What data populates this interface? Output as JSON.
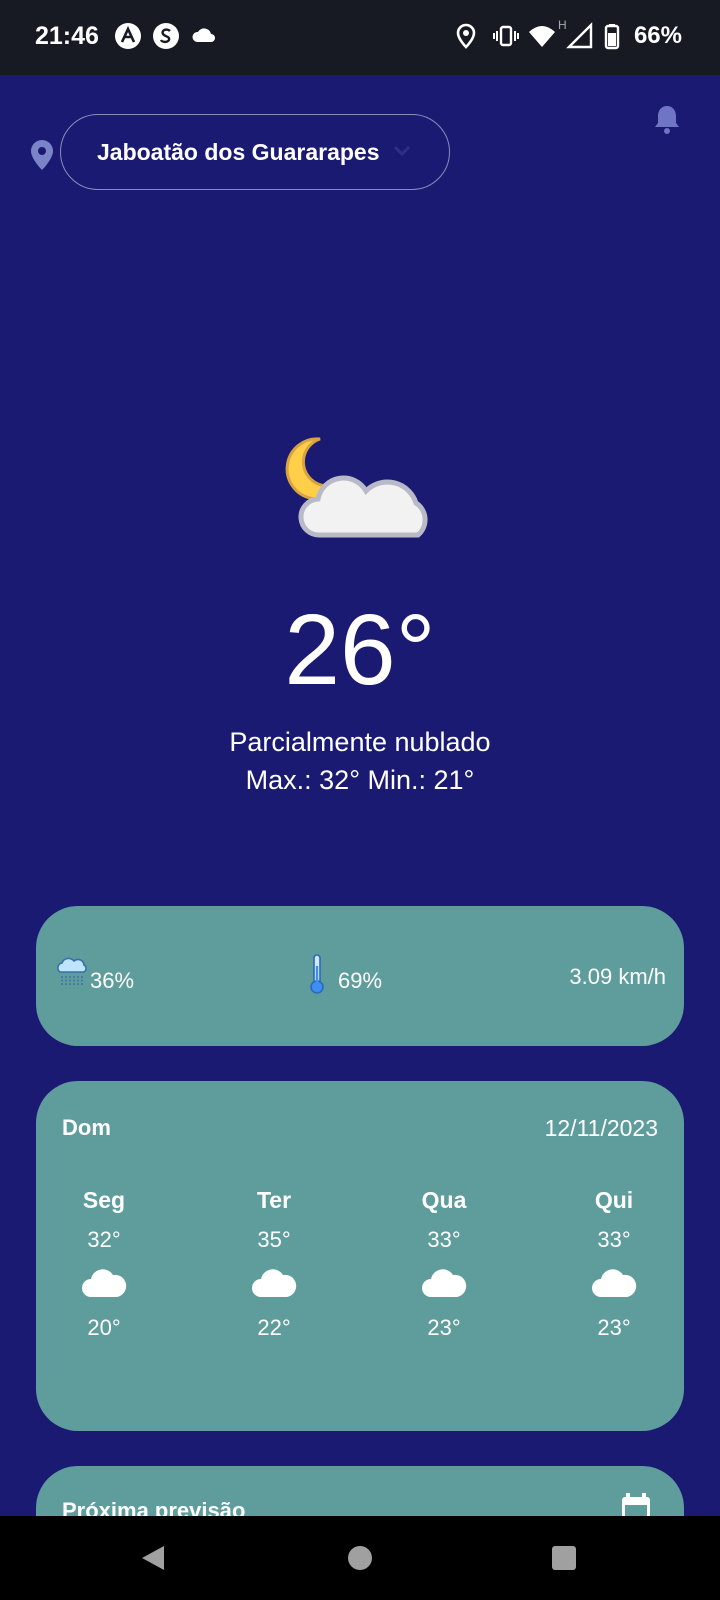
{
  "status_bar": {
    "time": "21:46",
    "battery": "66%",
    "left_icons": [
      "app-a-icon",
      "app-s-icon",
      "cloud-icon"
    ],
    "right_icons": [
      "location-icon",
      "vibrate-icon",
      "wifi-icon",
      "signal-icon",
      "battery-icon"
    ],
    "network_label": "H"
  },
  "header": {
    "city": "Jaboatão dos Guararapes",
    "location_icon": "location-pin-icon",
    "bell_icon": "bell-icon"
  },
  "current": {
    "icon": "partly-cloudy-night-icon",
    "temperature": "26°",
    "condition": "Parcialmente nublado",
    "minmax": "Max.: 32° Min.: 21°"
  },
  "metrics": {
    "rain": "36%",
    "humidity": "69%",
    "wind": "3.09 km/h"
  },
  "forecast": {
    "today_label": "Dom",
    "date": "12/11/2023",
    "days": [
      {
        "day": "Seg",
        "max": "32°",
        "min": "20°",
        "icon": "cloud-icon"
      },
      {
        "day": "Ter",
        "max": "35°",
        "min": "22°",
        "icon": "cloud-icon"
      },
      {
        "day": "Qua",
        "max": "33°",
        "min": "23°",
        "icon": "cloud-icon"
      },
      {
        "day": "Qui",
        "max": "33°",
        "min": "23°",
        "icon": "cloud-icon"
      }
    ]
  },
  "next_forecast": {
    "title": "Próxima previsão",
    "icon": "calendar-icon"
  },
  "colors": {
    "background": "#1b1a72",
    "card": "#5f9d9d",
    "status_bar": "#171a22"
  }
}
